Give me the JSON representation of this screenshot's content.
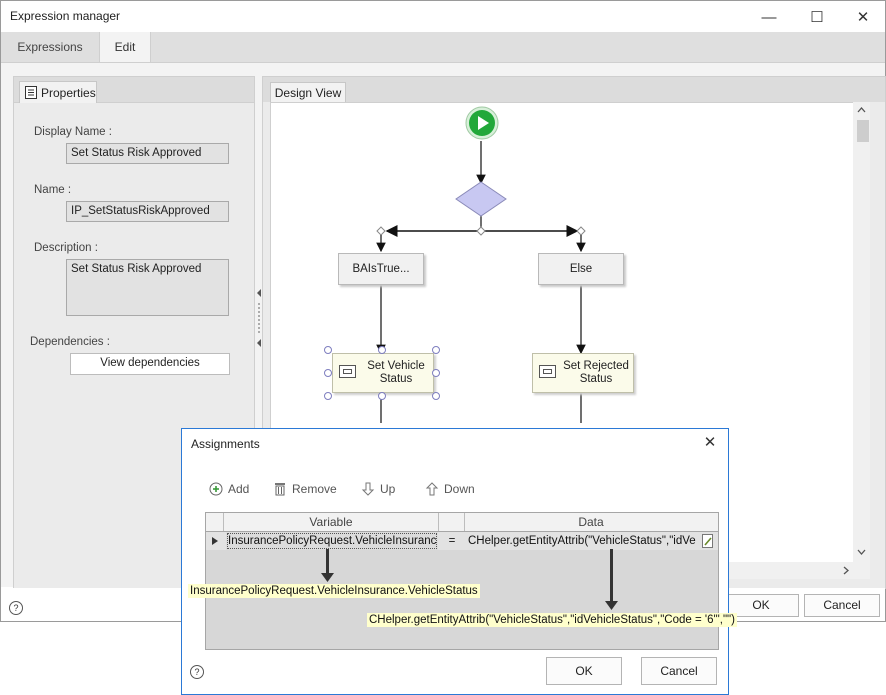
{
  "window": {
    "title": "Expression manager",
    "controls": {
      "minimize": "—",
      "maximize": "☐",
      "close": "✕"
    }
  },
  "tabs": [
    {
      "label": "Expressions",
      "active": false
    },
    {
      "label": "Edit",
      "active": true
    }
  ],
  "properties": {
    "tab_label": "Properties",
    "display_name_label": "Display Name :",
    "display_name_value": "Set Status Risk Approved",
    "name_label": "Name :",
    "name_value": "IP_SetStatusRiskApproved",
    "description_label": "Description :",
    "description_value": "Set Status Risk Approved",
    "dependencies_label": "Dependencies :",
    "view_dependencies_button": "View dependencies"
  },
  "design_view": {
    "tab_label": "Design View",
    "nodes": {
      "left_branch": "BAIsTrue...",
      "right_branch": "Else",
      "left_action_line1": "Set Vehicle",
      "left_action_line2": "Status",
      "right_action_line1": "Set Rejected",
      "right_action_line2": "Status"
    },
    "colors": {
      "start": "#22a83a",
      "decision": "#c8c8f2"
    }
  },
  "footer": {
    "help": "?",
    "ok_button": "OK",
    "cancel_button": "Cancel"
  },
  "assignments": {
    "title": "Assignments",
    "close": "✕",
    "toolbar": {
      "add": "Add",
      "remove": "Remove",
      "up": "Up",
      "down": "Down"
    },
    "grid": {
      "columns": [
        "Variable",
        "Data"
      ],
      "rows": [
        {
          "variable": "InsurancePolicyRequest.VehicleInsuranc",
          "operator": "=",
          "data": "CHelper.getEntityAttrib(\"VehicleStatus\",\"idVe"
        }
      ]
    },
    "callout_variable": "InsurancePolicyRequest.VehicleInsurance.VehicleStatus",
    "callout_data": "CHelper.getEntityAttrib(\"VehicleStatus\",\"idVehicleStatus\",\"Code = '6'\",\"\")",
    "help": "?",
    "ok_button": "OK",
    "cancel_button": "Cancel",
    "colors": {
      "border": "#2b79d6",
      "callout_bg": "#ffffcc"
    }
  }
}
